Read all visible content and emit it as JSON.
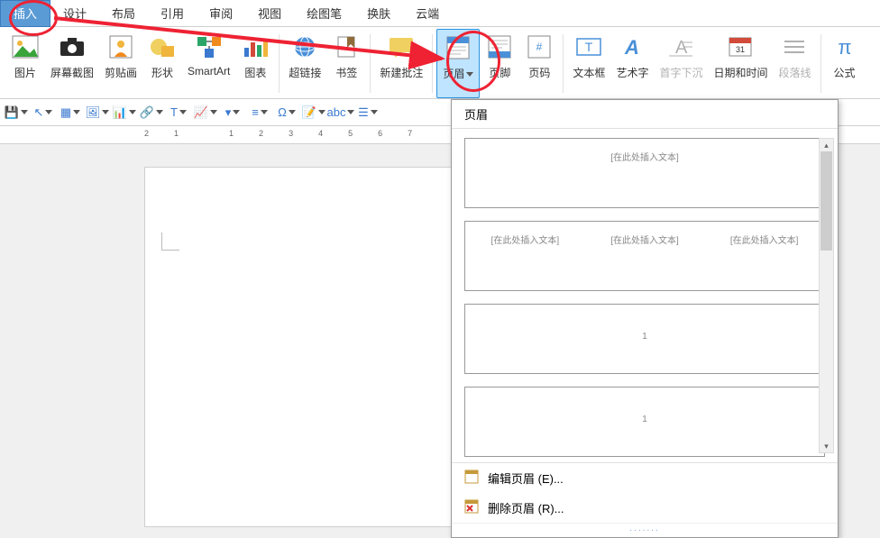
{
  "menu": {
    "tabs": [
      "插入",
      "设计",
      "布局",
      "引用",
      "审阅",
      "视图",
      "绘图笔",
      "换肤",
      "云端"
    ],
    "active_index": 0
  },
  "ribbon": {
    "items": [
      {
        "label": "图片",
        "icon": "image-icon",
        "color": "#38a43a"
      },
      {
        "label": "屏幕截图",
        "icon": "camera-icon",
        "color": "#2a2a2a"
      },
      {
        "label": "剪贴画",
        "icon": "clipart-icon",
        "color": "#f08a1e"
      },
      {
        "label": "形状",
        "icon": "shapes-icon",
        "color": "#f0b53c"
      },
      {
        "label": "SmartArt",
        "icon": "smartart-icon",
        "color": "#2aa668"
      },
      {
        "label": "图表",
        "icon": "chart-icon",
        "color": "#3a79cf"
      },
      {
        "label": "超链接",
        "icon": "hyperlink-icon",
        "color": "#3a79cf"
      },
      {
        "label": "书签",
        "icon": "bookmark-icon",
        "color": "#906c3a"
      },
      {
        "label": "新建批注",
        "icon": "comment-icon",
        "color": "#f0b53c"
      },
      {
        "label": "页眉",
        "icon": "header-icon",
        "color": "#3a79cf",
        "highlight": true
      },
      {
        "label": "页脚",
        "icon": "footer-icon",
        "color": "#3a79cf"
      },
      {
        "label": "页码",
        "icon": "pagenum-icon",
        "color": "#3a79cf"
      },
      {
        "label": "文本框",
        "icon": "textbox-icon",
        "color": "#3a79cf"
      },
      {
        "label": "艺术字",
        "icon": "wordart-icon",
        "color": "#3a79cf"
      },
      {
        "label": "首字下沉",
        "icon": "dropcap-icon",
        "color": "#b0b0b0",
        "disabled": true
      },
      {
        "label": "日期和时间",
        "icon": "datetime-icon",
        "color": "#d24a3a"
      },
      {
        "label": "段落线",
        "icon": "paraline-icon",
        "color": "#b0b0b0",
        "disabled": true
      },
      {
        "label": "公式",
        "icon": "equation-icon",
        "color": "#3a79cf"
      }
    ],
    "separators_after": [
      5,
      7,
      8,
      11,
      16
    ]
  },
  "toolbar2": {
    "icons": [
      "save-icon",
      "cursor-icon",
      "table-icon",
      "image-icon",
      "chart-mini-icon",
      "link-mini-icon",
      "textbox-mini-icon",
      "chart2-icon",
      "dropdown-icon",
      "align-icon",
      "omega-icon",
      "note-icon",
      "abc-icon",
      "bars-icon"
    ]
  },
  "ruler": {
    "units": [
      "2",
      "1",
      "",
      "1",
      "2",
      "3",
      "4",
      "5",
      "6",
      "7"
    ]
  },
  "dropdown": {
    "title": "页眉",
    "previews": [
      {
        "type": "single",
        "texts": [
          "[在此处插入文本]"
        ]
      },
      {
        "type": "three",
        "texts": [
          "[在此处插入文本]",
          "[在此处插入文本]",
          "[在此处插入文本]"
        ]
      },
      {
        "type": "single",
        "texts": [
          "1"
        ]
      },
      {
        "type": "single",
        "texts": [
          "1"
        ]
      }
    ],
    "menu": [
      {
        "label": "编辑页眉 (E)...",
        "icon": "edit-header-icon"
      },
      {
        "label": "删除页眉 (R)...",
        "icon": "delete-header-icon"
      }
    ]
  }
}
